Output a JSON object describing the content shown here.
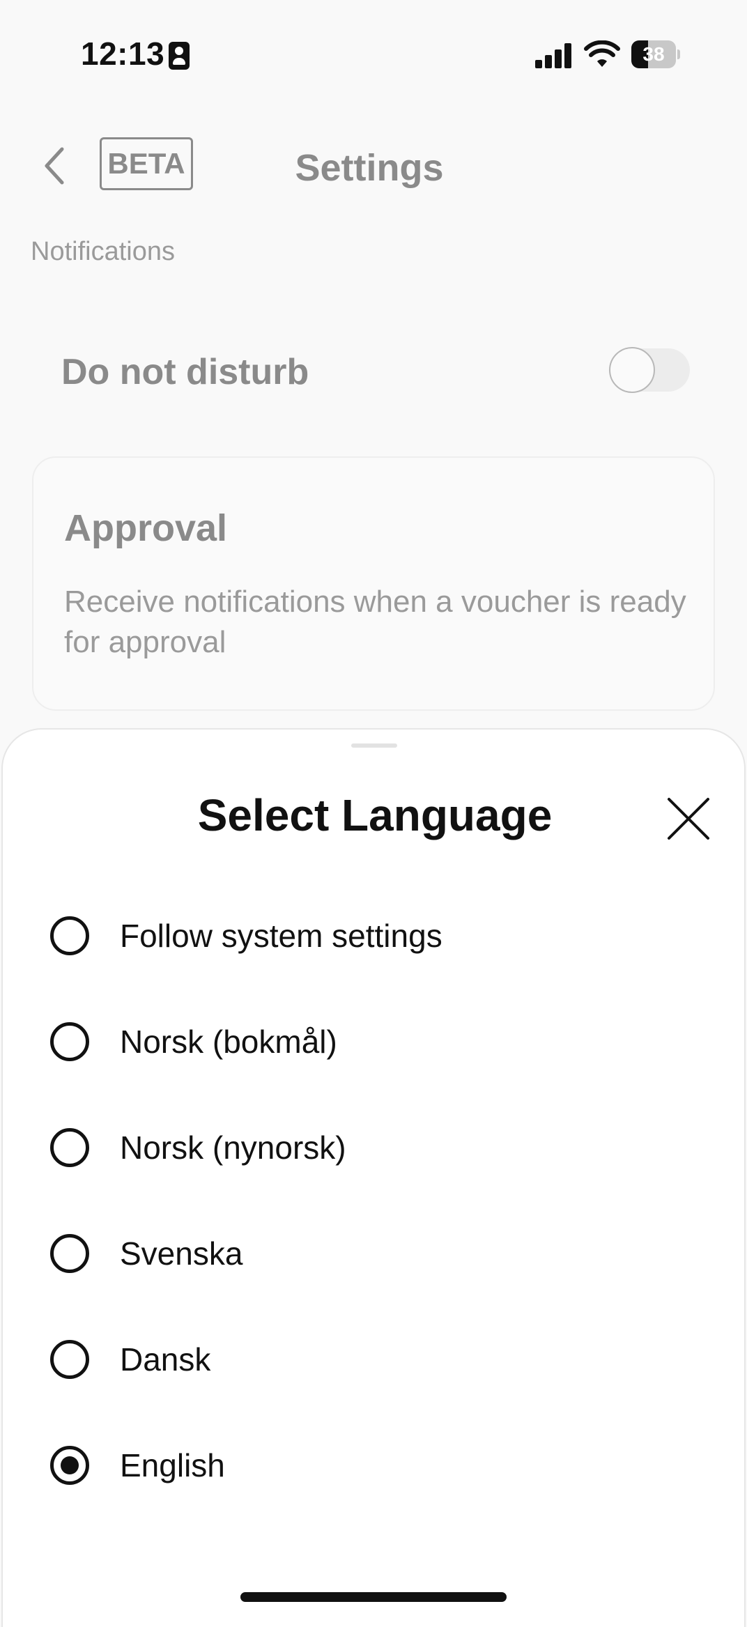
{
  "status_bar": {
    "time": "12:13",
    "battery_level": "38"
  },
  "header": {
    "back_icon": "chevron-left-icon",
    "badge": "BETA",
    "title": "Settings"
  },
  "notifications": {
    "section_label": "Notifications",
    "do_not_disturb": {
      "label": "Do not disturb",
      "enabled": false
    },
    "approval": {
      "title": "Approval",
      "description": "Receive notifications when a voucher is ready for approval"
    }
  },
  "language_sheet": {
    "title": "Select Language",
    "close_icon": "close-icon",
    "options": [
      {
        "label": "Follow system settings",
        "selected": false
      },
      {
        "label": "Norsk (bokmål)",
        "selected": false
      },
      {
        "label": "Norsk (nynorsk)",
        "selected": false
      },
      {
        "label": "Svenska",
        "selected": false
      },
      {
        "label": "Dansk",
        "selected": false
      },
      {
        "label": "English",
        "selected": true
      }
    ]
  },
  "colors": {
    "text_primary": "#111111",
    "text_muted": "#8a8a8a",
    "background": "#f9f9f9",
    "sheet_background": "#ffffff"
  }
}
